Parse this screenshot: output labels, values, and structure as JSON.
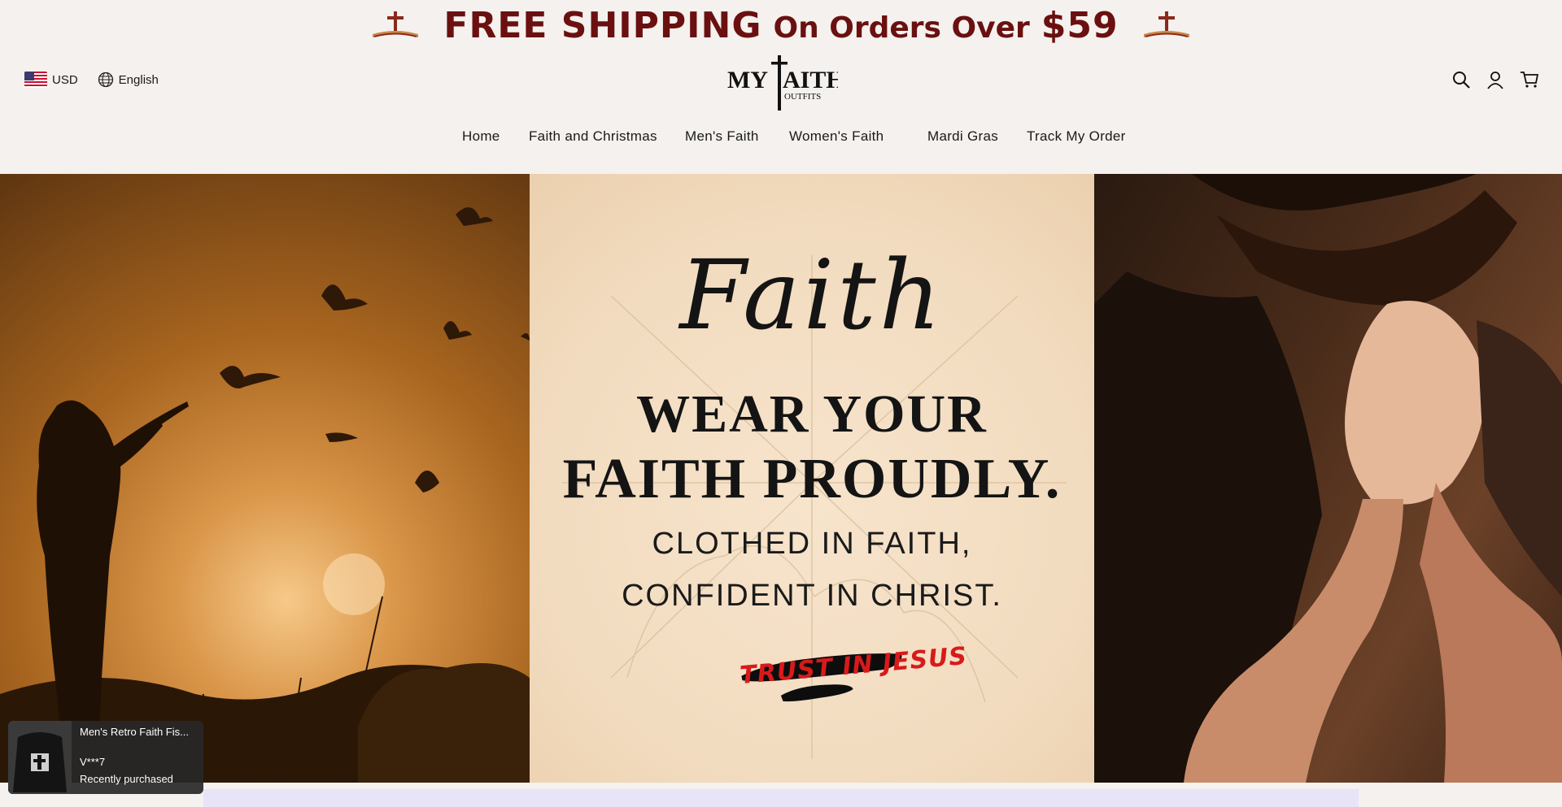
{
  "announcement": {
    "free_shipping": "FREE SHIPPING",
    "on_orders_over": "On Orders Over",
    "amount": "$59"
  },
  "header": {
    "currency": "USD",
    "language": "English",
    "logo_text": "MYFAITH OUTFITS"
  },
  "nav": {
    "items": [
      {
        "label": "Home"
      },
      {
        "label": "Faith and Christmas"
      },
      {
        "label": "Men's Faith"
      },
      {
        "label": "Women's Faith"
      },
      {
        "label": "Mardi Gras"
      },
      {
        "label": "Track My Order"
      }
    ]
  },
  "hero": {
    "script_word": "Faith",
    "headline_line1": "WEAR YOUR",
    "headline_line2": "FAITH PROUDLY.",
    "sub_line1": "CLOTHED IN FAITH,",
    "sub_line2": "CONFIDENT IN CHRIST.",
    "tag": "TRUST IN JESUS"
  },
  "popup": {
    "product": "Men's Retro Faith Fis...",
    "user": "V***7",
    "status": "Recently purchased"
  },
  "colors": {
    "announcement": "#6a1010",
    "background": "#f4f1ee",
    "trust_red": "#d81a1a"
  }
}
